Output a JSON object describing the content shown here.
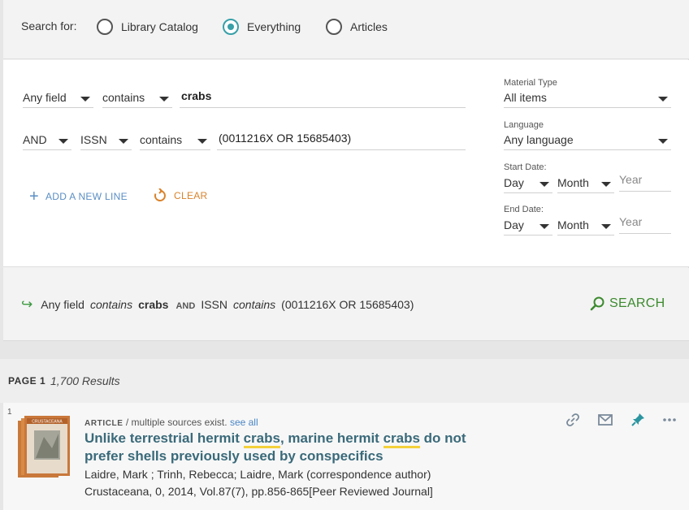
{
  "scope": {
    "label": "Search for:",
    "options": [
      {
        "label": "Library Catalog",
        "checked": false
      },
      {
        "label": "Everything",
        "checked": true
      },
      {
        "label": "Articles",
        "checked": false
      }
    ]
  },
  "query_lines": [
    {
      "field": "Any field",
      "operator": "contains",
      "value": "crabs"
    },
    {
      "boolean": "AND",
      "field": "ISSN",
      "operator": "contains",
      "value": "(0011216X OR 15685403)"
    }
  ],
  "filters": {
    "material_type": {
      "label": "Material Type",
      "value": "All items"
    },
    "language": {
      "label": "Language",
      "value": "Any language"
    },
    "start_date": {
      "label": "Start Date:",
      "day": "Day",
      "month": "Month",
      "year_placeholder": "Year"
    },
    "end_date": {
      "label": "End Date:",
      "day": "Day",
      "month": "Month",
      "year_placeholder": "Year"
    }
  },
  "actions": {
    "add_line": "ADD A NEW LINE",
    "clear": "CLEAR"
  },
  "summary": {
    "field1": "Any field",
    "op1": "contains",
    "val1": "crabs",
    "boolean": "AND",
    "field2": "ISSN",
    "op2": "contains",
    "val2": "(0011216X OR 15685403)",
    "search_label": "SEARCH"
  },
  "results_header": {
    "page": "PAGE 1",
    "count": "1,700 Results"
  },
  "result": {
    "number": "1",
    "type": "ARTICLE",
    "type_note": "/ multiple sources exist.",
    "see_all": "see all",
    "title_parts": [
      "Unlike terrestrial hermit ",
      "crabs",
      ", marine hermit ",
      "crabs",
      " do not prefer shells previously used by conspecifics"
    ],
    "authors": "Laidre, Mark ; Trinh, Rebecca; Laidre, Mark (correspondence author)",
    "source": "Crustaceana, 0, 2014, Vol.87(7), pp.856-865[Peer Reviewed Journal]",
    "thumb_text": "CRUSTACEANA",
    "icons": [
      "link-icon",
      "email-icon",
      "pin-icon",
      "more-icon"
    ]
  },
  "colors": {
    "accent_teal": "#37a0a8",
    "search_green": "#3c8a2e",
    "add_blue": "#5a8ec4",
    "clear_orange": "#d9822b",
    "highlight_yellow": "#f4d13b",
    "title_color": "#3a6a7a"
  }
}
